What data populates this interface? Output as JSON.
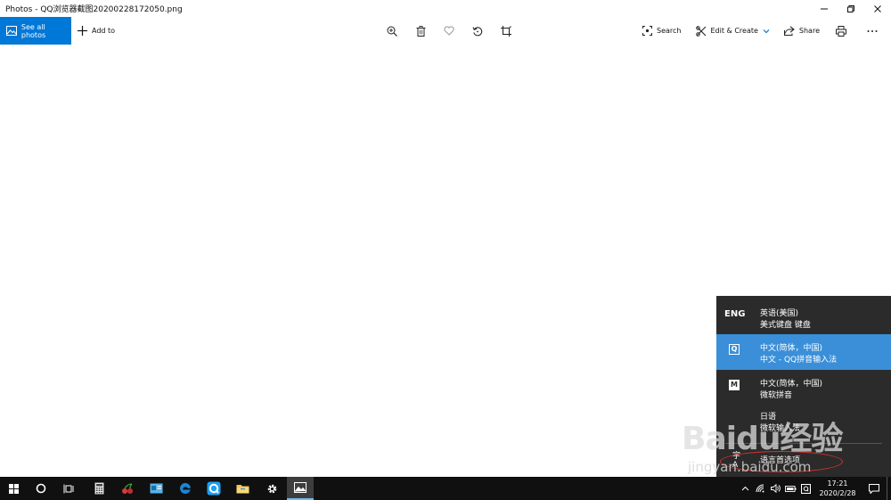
{
  "window": {
    "title": "Photos - QQ浏览器截图20200228172050.png"
  },
  "toolbar": {
    "see_all_photos": "See all photos",
    "add_to": "Add to",
    "search": "Search",
    "edit_create": "Edit & Create",
    "share": "Share"
  },
  "language_flyout": {
    "items": [
      {
        "code": "ENG",
        "name": "英语(美国)",
        "sub": "美式键盘 键盘"
      },
      {
        "code": "Q",
        "name": "中文(简体，中国)",
        "sub": "中文 - QQ拼音输入法"
      },
      {
        "code": "M",
        "name": "中文(简体，中国)",
        "sub": "微软拼音"
      },
      {
        "code": "",
        "name": "日语",
        "sub": "微软输入法"
      }
    ],
    "preferences_icon": "字A",
    "preferences_label": "语言首选项"
  },
  "watermark": {
    "text": "Baidu经验",
    "url": "jingyan.baidu.com"
  },
  "taskbar": {
    "time": "17:21",
    "date": "2020/2/28"
  },
  "colors": {
    "accent": "#0078d7",
    "flyout_bg": "#2b2b2b",
    "flyout_selected": "#3a8fd8",
    "taskbar_bg": "#101010",
    "highlight_ring": "#d9302b"
  }
}
